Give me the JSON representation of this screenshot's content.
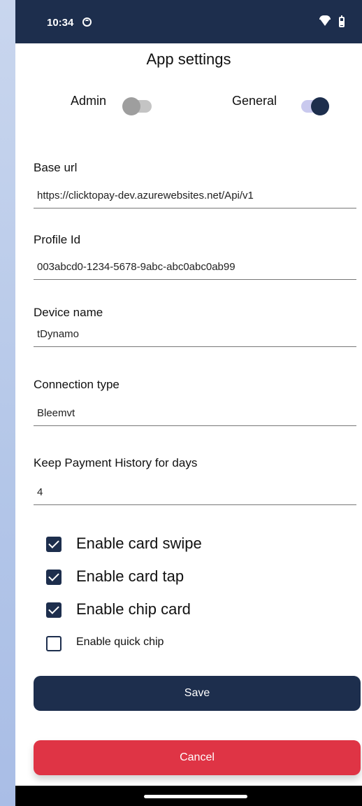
{
  "status_bar": {
    "time": "10:34"
  },
  "header": {
    "title": "App settings"
  },
  "toggles": {
    "admin": {
      "label": "Admin",
      "on": false
    },
    "general": {
      "label": "General",
      "on": true
    }
  },
  "fields": {
    "base_url": {
      "label": "Base url",
      "value": "https://clicktopay-dev.azurewebsites.net/Api/v1"
    },
    "profile_id": {
      "label": "Profile Id",
      "value": "003abcd0-1234-5678-9abc-abc0abc0ab99"
    },
    "device_name": {
      "label": "Device name",
      "value": "tDynamo"
    },
    "connection_type": {
      "label": "Connection type",
      "value": "Bleemvt"
    },
    "payment_history": {
      "label": "Keep Payment History for days",
      "value": "4"
    }
  },
  "checkboxes": [
    {
      "label": "Enable card swipe",
      "checked": true
    },
    {
      "label": "Enable card tap",
      "checked": true
    },
    {
      "label": "Enable chip card",
      "checked": true
    },
    {
      "label": "Enable quick chip",
      "checked": false
    }
  ],
  "buttons": {
    "save": "Save",
    "cancel": "Cancel"
  },
  "colors": {
    "primary": "#1d2e4d",
    "danger": "#df3445",
    "toggle_on_track": "#c9c9ee",
    "toggle_off": "#9e9e9e"
  }
}
